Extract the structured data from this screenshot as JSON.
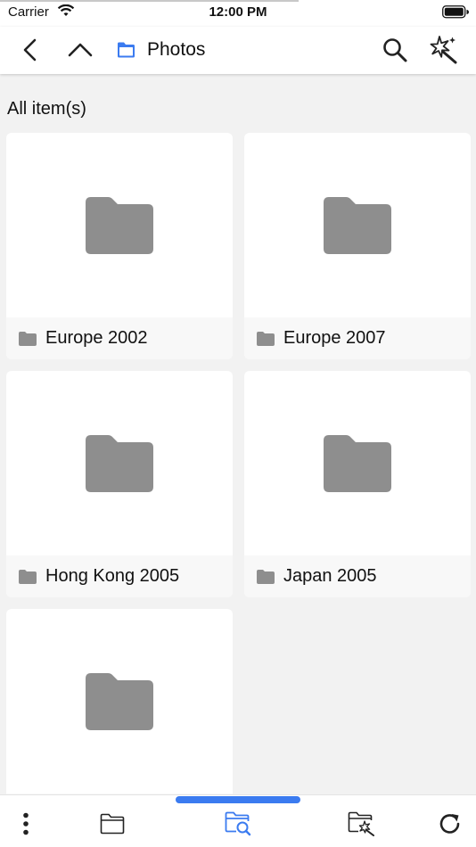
{
  "status_bar": {
    "carrier": "Carrier",
    "time": "12:00 PM"
  },
  "nav": {
    "title": "Photos",
    "icons": [
      "back-chevron-icon",
      "up-chevron-icon",
      "folder-icon",
      "search-icon",
      "magic-wand-icon"
    ]
  },
  "section": {
    "label": "All item(s)"
  },
  "items": [
    {
      "name": "Europe 2002"
    },
    {
      "name": "Europe 2007"
    },
    {
      "name": "Hong Kong 2005"
    },
    {
      "name": "Japan 2005"
    },
    {
      "name": ""
    }
  ],
  "tab_bar": {
    "tabs": [
      "more-icon",
      "folder-icon",
      "folder-search-icon",
      "magic-folder-icon",
      "refresh-icon"
    ],
    "active_index": 2
  },
  "colors": {
    "accent": "#3b7bf0",
    "folder_gray": "#8e8e8e",
    "icon_dark": "#222222",
    "background": "#f2f2f2"
  }
}
